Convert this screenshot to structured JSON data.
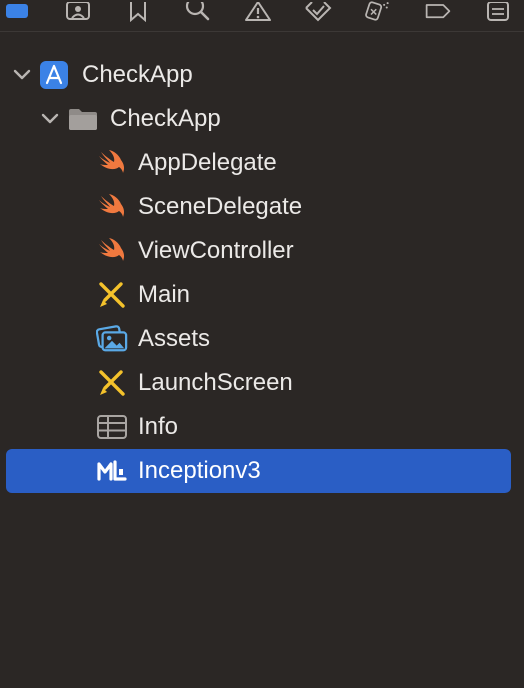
{
  "toolbar": {
    "icons": [
      "project-navigator-icon",
      "source-control-icon",
      "bookmark-icon",
      "find-icon",
      "issue-warning-icon",
      "test-navigator-icon",
      "debug-navigator-icon",
      "breakpoint-icon",
      "report-icon"
    ]
  },
  "tree": {
    "project": {
      "label": "CheckApp",
      "icon": "xcode-project-icon",
      "expanded": true
    },
    "group": {
      "label": "CheckApp",
      "icon": "folder-icon",
      "expanded": true
    },
    "files": [
      {
        "label": "AppDelegate",
        "icon": "swift-file-icon"
      },
      {
        "label": "SceneDelegate",
        "icon": "swift-file-icon"
      },
      {
        "label": "ViewController",
        "icon": "swift-file-icon"
      },
      {
        "label": "Main",
        "icon": "storyboard-icon"
      },
      {
        "label": "Assets",
        "icon": "asset-catalog-icon"
      },
      {
        "label": "LaunchScreen",
        "icon": "storyboard-icon"
      },
      {
        "label": "Info",
        "icon": "plist-table-icon"
      },
      {
        "label": "Inceptionv3",
        "icon": "mlmodel-icon",
        "selected": true
      }
    ]
  },
  "colors": {
    "background": "#2b2725",
    "selection": "#2a5ec5",
    "swift": "#f0793f",
    "storyboard": "#f4c22b",
    "assets": "#5aa9e6",
    "project": "#3b82e6"
  }
}
